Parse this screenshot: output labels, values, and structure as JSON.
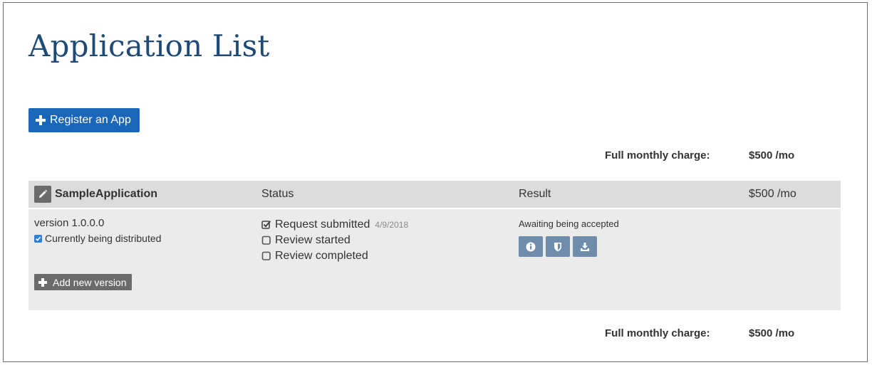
{
  "page": {
    "title": "Application List"
  },
  "actions": {
    "register_label": "Register an App"
  },
  "charges": {
    "top_label": "Full monthly charge:",
    "top_value": "$500 /mo",
    "bottom_label": "Full monthly charge:",
    "bottom_value": "$500 /mo"
  },
  "table": {
    "app_name": "SampleApplication",
    "status_header": "Status",
    "result_header": "Result",
    "price": "$500 /mo",
    "version": "version 1.0.0.0",
    "distributed_label": "Currently being distributed",
    "distributed_checked": true,
    "status_items": [
      {
        "label": "Request submitted",
        "date": "4/9/2018",
        "checked": true
      },
      {
        "label": "Review started",
        "checked": false
      },
      {
        "label": "Review completed",
        "checked": false
      }
    ],
    "result_text": "Awaiting being accepted",
    "result_icons": [
      "info-icon",
      "shield-icon",
      "download-icon"
    ],
    "add_version_label": "Add new version"
  },
  "colors": {
    "title": "#1e4a78",
    "primary_button": "#1a66b8",
    "header_bg": "#dcdcdc",
    "row_bg": "#ebebeb",
    "result_icon_bg": "#6f8cab",
    "dark_button": "#6b6b6b"
  }
}
